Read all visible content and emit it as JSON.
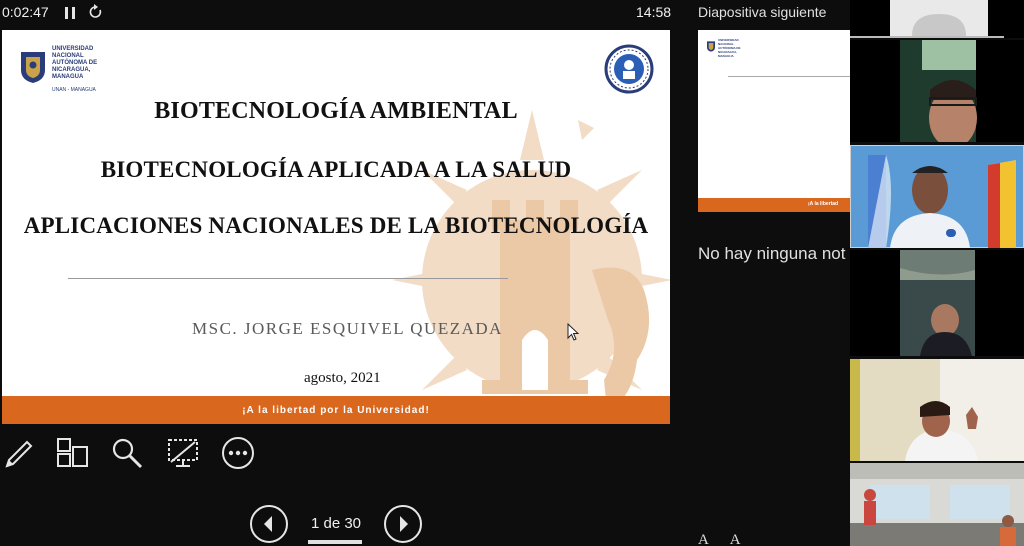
{
  "header": {
    "elapsed_time": "0:02:47",
    "clock": "14:58",
    "next_slide_label": "Diapositiva siguiente"
  },
  "slide": {
    "institution_lines": [
      "UNIVERSIDAD",
      "NACIONAL",
      "AUTÓNOMA DE",
      "NICARAGUA,",
      "MANAGUA"
    ],
    "institution_sub": "UNAN - MANAGUA",
    "title_1": "BIOTECNOLOGÍA AMBIENTAL",
    "title_2": "BIOTECNOLOGÍA APLICADA A LA SALUD",
    "title_3": "APLICACIONES NACIONALES DE LA BIOTECNOLOGÍA",
    "author": "MSC. JORGE ESQUIVEL QUEZADA",
    "date": "agosto, 2021",
    "footer": "¡A la libertad por la Universidad!"
  },
  "next_slide": {
    "footer": "¡A la libertad"
  },
  "notes": {
    "text": "No hay ninguna not"
  },
  "pager": {
    "page_text": "1 de 30"
  },
  "font_controls": {
    "increase": "A",
    "decrease": "A"
  },
  "colors": {
    "accent": "#d9671e",
    "background": "#0d0d0d",
    "navy": "#2a3d78"
  },
  "icons": [
    "pause-icon",
    "reset-icon",
    "pen-icon",
    "slides-grid-icon",
    "zoom-icon",
    "screen-off-icon",
    "more-options-icon",
    "arrow-left-icon",
    "arrow-right-icon",
    "mouse-cursor-icon"
  ]
}
